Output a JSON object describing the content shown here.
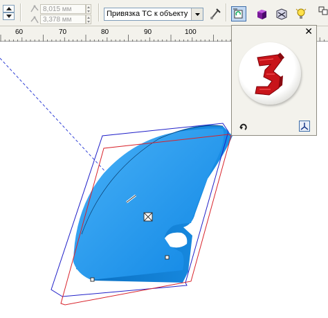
{
  "toolbar": {
    "position_x_value": "8,015 мм",
    "position_y_value": "3,378 мм",
    "vanishing_point_lock": "Привязка ТС к объекту"
  },
  "ruler": {
    "ticks": [
      "60",
      "70",
      "80",
      "90",
      "100"
    ]
  },
  "docker": {
    "close_symbol": "✕"
  },
  "colors": {
    "extrude_face": "#1b8ee8",
    "extrude_side": "#0a73c8",
    "bounding_box": "#1f1fc8",
    "projection_box": "#d8222a",
    "vanishing_line": "#2f3fd6",
    "preview_glyph": "#c8141a",
    "toolbar_bg": "#f3f2ec"
  },
  "icons": [
    "spin-up-icon",
    "spin-down-icon",
    "object-size-icon",
    "dropdown-arrow-icon",
    "copy-vp-icon",
    "extrude-rotation-icon",
    "extrude-color-icon",
    "extrude-bevel-icon",
    "extrude-lighting-icon",
    "reset-rotation-icon",
    "rotation-mode-icon"
  ]
}
